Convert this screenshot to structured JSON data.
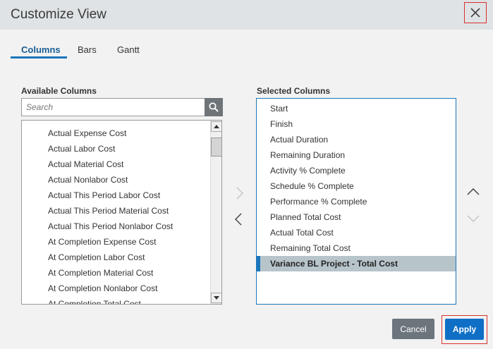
{
  "dialog": {
    "title": "Customize View",
    "close_icon": "close-icon"
  },
  "tabs": [
    {
      "label": "Columns",
      "active": true
    },
    {
      "label": "Bars",
      "active": false
    },
    {
      "label": "Gantt",
      "active": false
    }
  ],
  "available": {
    "label": "Available Columns",
    "search_placeholder": "Search",
    "search_value": "",
    "items": [
      "Actual Expense Cost",
      "Actual Labor Cost",
      "Actual Material Cost",
      "Actual Nonlabor Cost",
      "Actual This Period Labor Cost",
      "Actual This Period Material Cost",
      "Actual This Period Nonlabor Cost",
      "At Completion Expense Cost",
      "At Completion Labor Cost",
      "At Completion Material Cost",
      "At Completion Nonlabor Cost",
      "At Completion Total Cost"
    ]
  },
  "selected": {
    "label": "Selected Columns",
    "items": [
      "Start",
      "Finish",
      "Actual Duration",
      "Remaining Duration",
      "Activity % Complete",
      "Schedule % Complete",
      "Performance % Complete",
      "Planned Total Cost",
      "Actual Total Cost",
      "Remaining Total Cost",
      "Variance BL Project - Total Cost"
    ],
    "selected_item": "Variance BL Project - Total Cost"
  },
  "buttons": {
    "cancel": "Cancel",
    "apply": "Apply"
  },
  "colors": {
    "accent": "#1a76bb",
    "highlight_frame": "#d9302e",
    "selected_row": "#b7c4ca",
    "cancel_bg": "#6c747c",
    "apply_bg": "#0f6fc6"
  }
}
